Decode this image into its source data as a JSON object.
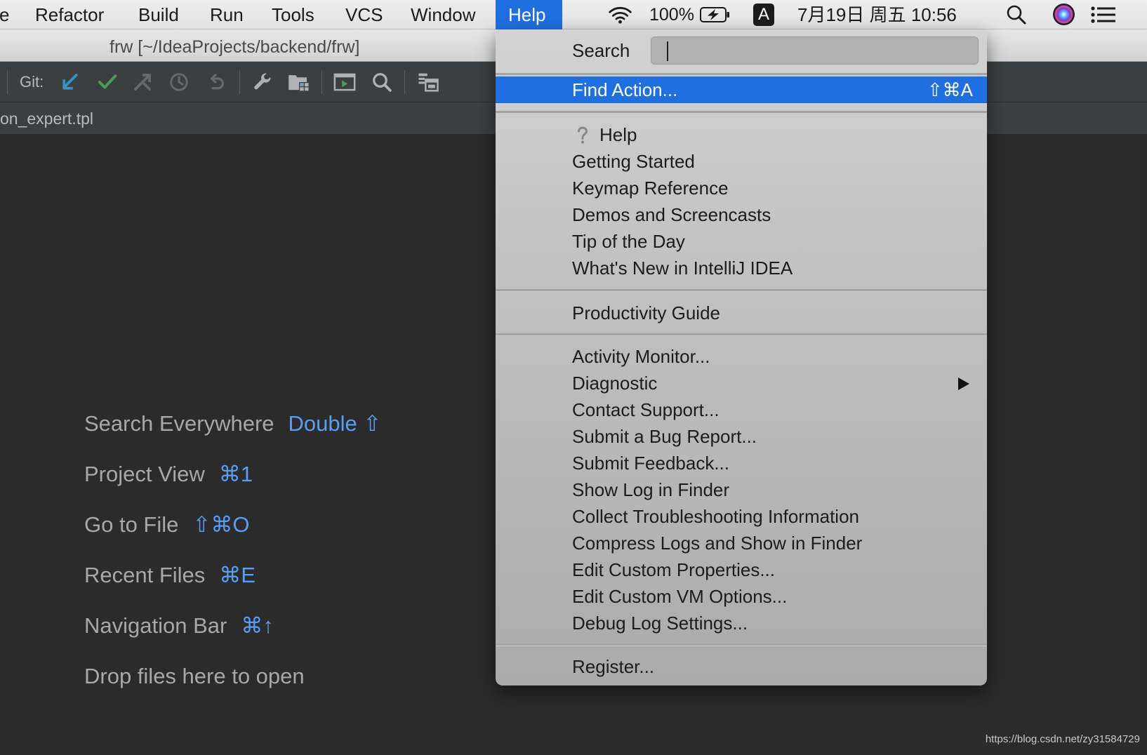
{
  "colors": {
    "menu_highlight": "#1f6fe0",
    "shortcut_blue": "#589df6",
    "editor_background": "#2b2b2b",
    "toolbar_background": "#3c3f41",
    "git_update_blue": "#3592c4",
    "git_commit_green": "#499c54"
  },
  "menubar": {
    "items": [
      "e",
      "Refactor",
      "Build",
      "Run",
      "Tools",
      "VCS",
      "Window",
      "Help"
    ],
    "active_item": "Help",
    "status": {
      "battery_percent": "100%",
      "input_source": "A",
      "datetime": "7月19日 周五 10:56"
    },
    "status_icons": [
      "wifi-icon",
      "battery-charging-icon",
      "spotlight-search-icon",
      "siri-icon",
      "notification-center-icon"
    ]
  },
  "window": {
    "title": "frw [~/IdeaProjects/backend/frw]"
  },
  "toolbar": {
    "git_label": "Git:",
    "icons": [
      "git-update-icon",
      "git-commit-icon",
      "git-push-icon",
      "git-history-icon",
      "git-rollback-icon",
      "settings-wrench-icon",
      "project-structure-icon",
      "run-window-icon",
      "search-icon",
      "structure-icon"
    ]
  },
  "editor_tab": {
    "label": "on_expert.tpl"
  },
  "empty_editor": {
    "hints": [
      {
        "label": "Search Everywhere",
        "shortcut": "Double ⇧"
      },
      {
        "label": "Project View",
        "shortcut": "⌘1"
      },
      {
        "label": "Go to File",
        "shortcut": "⇧⌘O"
      },
      {
        "label": "Recent Files",
        "shortcut": "⌘E"
      },
      {
        "label": "Navigation Bar",
        "shortcut": "⌘↑"
      },
      {
        "label": "Drop files here to open"
      }
    ]
  },
  "help_menu": {
    "search": {
      "label": "Search",
      "value": ""
    },
    "groups": [
      [
        {
          "label": "Find Action...",
          "shortcut": "⇧⌘A",
          "highlighted": true
        }
      ],
      [
        {
          "label": "Help",
          "icon": "help-question-icon"
        },
        {
          "label": "Getting Started"
        },
        {
          "label": "Keymap Reference"
        },
        {
          "label": "Demos and Screencasts"
        },
        {
          "label": "Tip of the Day"
        },
        {
          "label": "What's New in IntelliJ IDEA"
        }
      ],
      [
        {
          "label": "Productivity Guide"
        }
      ],
      [
        {
          "label": "Activity Monitor..."
        },
        {
          "label": "Diagnostic",
          "submenu": true
        },
        {
          "label": "Contact Support..."
        },
        {
          "label": "Submit a Bug Report..."
        },
        {
          "label": "Submit Feedback..."
        },
        {
          "label": "Show Log in Finder"
        },
        {
          "label": "Collect Troubleshooting Information"
        },
        {
          "label": "Compress Logs and Show in Finder"
        },
        {
          "label": "Edit Custom Properties..."
        },
        {
          "label": "Edit Custom VM Options..."
        },
        {
          "label": "Debug Log Settings..."
        }
      ],
      [
        {
          "label": "Register..."
        }
      ]
    ]
  },
  "watermark": "https://blog.csdn.net/zy31584729"
}
